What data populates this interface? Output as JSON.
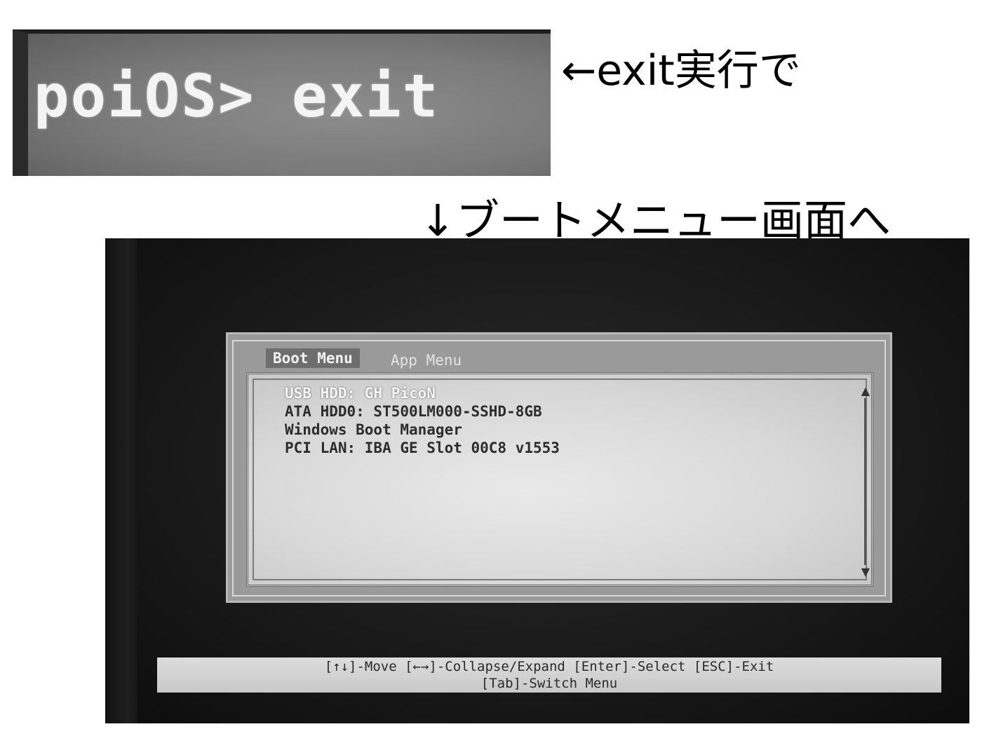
{
  "prompt_photo": {
    "prompt_text": "poiOS> exit"
  },
  "captions": {
    "exit_caption": "←exit実行で",
    "boot_caption": "↓ブートメニュー画面へ"
  },
  "boot_screen": {
    "tabs": [
      {
        "label": "Boot Menu",
        "active": true
      },
      {
        "label": "App Menu",
        "active": false
      }
    ],
    "boot_items": [
      {
        "label": "USB HDD: GH PicoN",
        "selected": true
      },
      {
        "label": "ATA HDD0: ST500LM000-SSHD-8GB",
        "selected": false
      },
      {
        "label": "Windows Boot Manager",
        "selected": false
      },
      {
        "label": "PCI LAN: IBA GE Slot 00C8 v1553",
        "selected": false
      }
    ],
    "help": {
      "line1": "[↑↓]-Move [←→]-Collapse/Expand [Enter]-Select [ESC]-Exit",
      "line2": "[Tab]-Switch Menu"
    },
    "scroll_up_icon": "▲",
    "scroll_down_icon": "▼"
  }
}
